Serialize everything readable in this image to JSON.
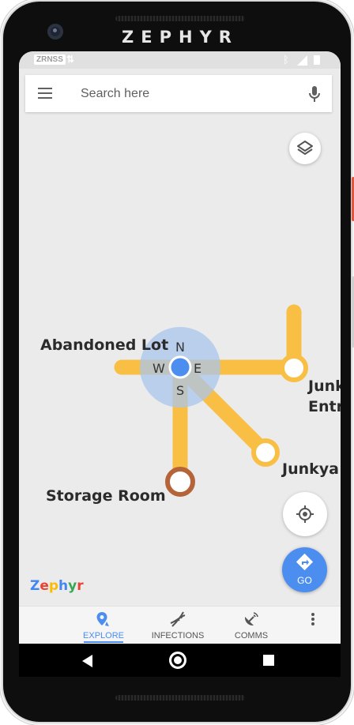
{
  "device": {
    "brand": "ZEPHYR"
  },
  "status_bar": {
    "carrier": "ZRNSS",
    "data_icon": "data-arrows-icon",
    "bluetooth_icon": "bluetooth-icon",
    "signal_icon": "signal-icon",
    "battery_icon": "battery-icon"
  },
  "search": {
    "placeholder": "Search here",
    "value": ""
  },
  "map": {
    "places": [
      "Abandoned Lot",
      "Junk Entr",
      "Junkya",
      "Storage Room"
    ],
    "junk_line1": "Junk",
    "junk_line2": "Entr",
    "compass": {
      "n": "N",
      "s": "S",
      "e": "E",
      "w": "W"
    },
    "path_color": "#f9bf45",
    "storage_node_color": "#b5643a",
    "current_location_color": "#4b8ef0"
  },
  "buttons": {
    "go_label": "GO",
    "layers_icon": "layers-icon",
    "my_location_icon": "my-location-icon",
    "directions_icon": "directions-icon"
  },
  "logo": {
    "text": "Zephyr",
    "letters": [
      "Z",
      "e",
      "p",
      "h",
      "y",
      "r"
    ],
    "colors": [
      "#4285f4",
      "#ea4335",
      "#fbbc05",
      "#4285f4",
      "#34a853",
      "#ea4335"
    ]
  },
  "bottom_nav": {
    "tabs": [
      {
        "label": "EXPLORE",
        "icon": "explore-pin-icon",
        "active": true
      },
      {
        "label": "INFECTIONS",
        "icon": "dna-icon",
        "active": false
      },
      {
        "label": "COMMS",
        "icon": "satellite-dish-icon",
        "active": false
      }
    ]
  },
  "accent": "#4b8ef0"
}
